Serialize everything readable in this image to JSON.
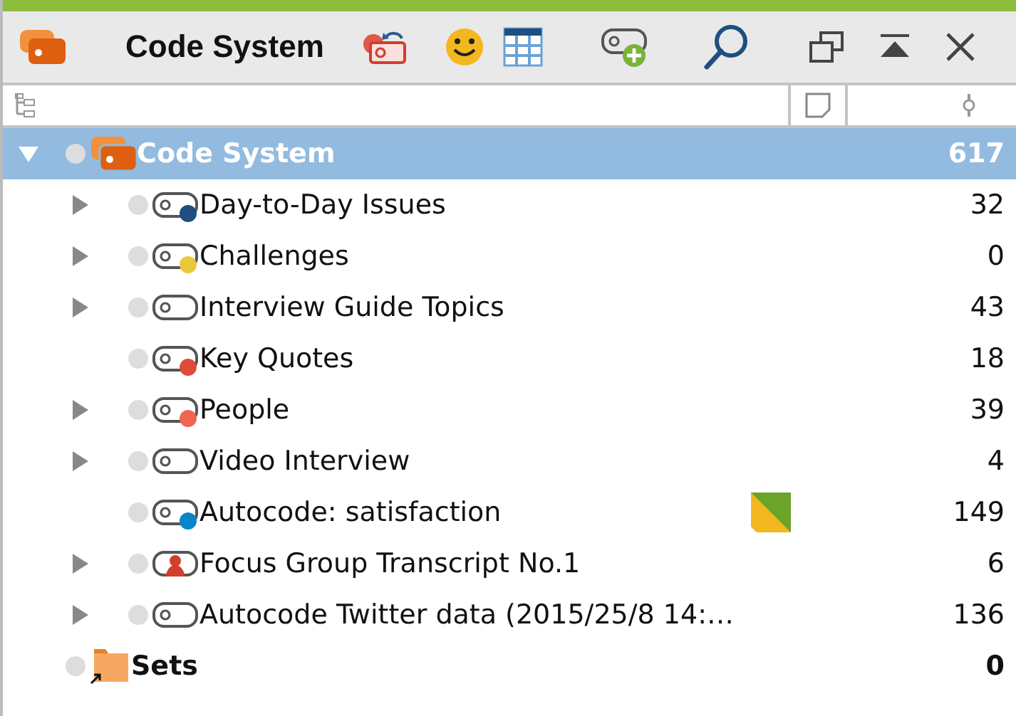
{
  "window": {
    "title": "Code System"
  },
  "tree": [
    {
      "label": "Code System",
      "count": "617",
      "kind": "root",
      "selected": true,
      "expanded": true,
      "children": [
        {
          "label": "Day-to-Day Issues",
          "count": "32",
          "kind": "code",
          "has_children": true,
          "memo": false,
          "color": "#1f4e80"
        },
        {
          "label": "Challenges",
          "count": "0",
          "kind": "code",
          "has_children": true,
          "memo": false,
          "color": "#e8c93a"
        },
        {
          "label": "Interview Guide Topics",
          "count": "43",
          "kind": "code",
          "has_children": true,
          "memo": false
        },
        {
          "label": "Key Quotes",
          "count": "18",
          "kind": "code",
          "has_children": false,
          "memo": false,
          "color": "#e04a38"
        },
        {
          "label": "People",
          "count": "39",
          "kind": "code",
          "has_children": true,
          "memo": false,
          "color": "#f06650"
        },
        {
          "label": "Video Interview",
          "count": "4",
          "kind": "code",
          "has_children": true,
          "memo": false
        },
        {
          "label": "Autocode: satisfaction",
          "count": "149",
          "kind": "code",
          "has_children": false,
          "memo": true,
          "color": "#0a84c8"
        },
        {
          "label": "Focus Group Transcript No.1",
          "count": "6",
          "kind": "group",
          "has_children": true,
          "memo": false
        },
        {
          "label": "Autocode Twitter data (2015/25/8 14:…",
          "count": "136",
          "kind": "code",
          "has_children": true,
          "memo": false
        }
      ]
    },
    {
      "label": "Sets",
      "count": "0",
      "kind": "sets",
      "selected": false
    }
  ]
}
